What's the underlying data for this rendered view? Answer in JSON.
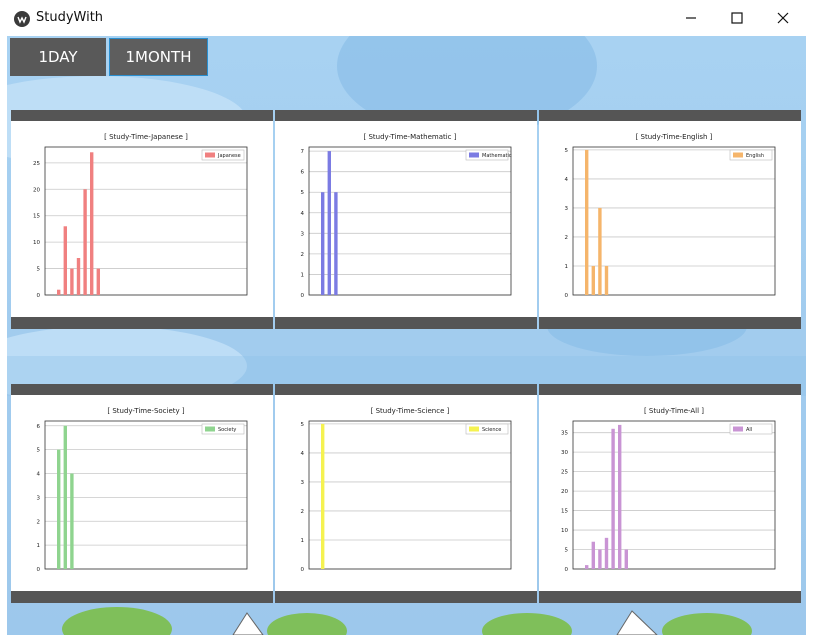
{
  "window": {
    "title": "StudyWith"
  },
  "toolbar": {
    "tab_day": "1DAY",
    "tab_month": "1MONTH",
    "active_tab": "1MONTH"
  },
  "chart_data": [
    {
      "type": "bar",
      "title": "[ Study-Time-Japanese ]",
      "series": [
        {
          "name": "Japanese",
          "values": [
            1,
            13,
            5,
            7,
            20,
            27,
            5
          ]
        }
      ],
      "color": "#f08080",
      "ylim": [
        0,
        28
      ],
      "yticks": [
        "0",
        "5",
        "10",
        "15",
        "20",
        "25"
      ],
      "grid": true,
      "legend": "top-right"
    },
    {
      "type": "bar",
      "title": "[ Study-Time-Mathematic ]",
      "series": [
        {
          "name": "Mathematic",
          "values": [
            5,
            7,
            5
          ]
        }
      ],
      "color": "#7b7be3",
      "ylim": [
        0,
        7.2
      ],
      "yticks": [
        "0",
        "1",
        "2",
        "3",
        "4",
        "5",
        "6",
        "7"
      ],
      "grid": true,
      "legend": "top-right"
    },
    {
      "type": "bar",
      "title": "[ Study-Time-English ]",
      "series": [
        {
          "name": "English",
          "values": [
            5,
            1,
            3,
            1
          ]
        }
      ],
      "color": "#f5b56b",
      "ylim": [
        0,
        5.1
      ],
      "yticks": [
        "0",
        "1",
        "2",
        "3",
        "4",
        "5"
      ],
      "grid": true,
      "legend": "top-right"
    },
    {
      "type": "bar",
      "title": "[ Study-Time-Society ]",
      "series": [
        {
          "name": "Society",
          "values": [
            5,
            6,
            4
          ]
        }
      ],
      "color": "#8fd48f",
      "ylim": [
        0,
        6.2
      ],
      "yticks": [
        "0",
        "1",
        "2",
        "3",
        "4",
        "5",
        "6"
      ],
      "grid": true,
      "legend": "top-right"
    },
    {
      "type": "bar",
      "title": "[ Study-Time-Science ]",
      "series": [
        {
          "name": "Science",
          "values": [
            5
          ]
        }
      ],
      "color": "#f5f250",
      "ylim": [
        0,
        5.1
      ],
      "yticks": [
        "0",
        "1",
        "2",
        "3",
        "4",
        "5"
      ],
      "grid": true,
      "legend": "top-right"
    },
    {
      "type": "bar",
      "title": "[ Study-Time-All ]",
      "series": [
        {
          "name": "All",
          "values": [
            1,
            7,
            5,
            8,
            36,
            37,
            5
          ]
        }
      ],
      "color": "#c994d4",
      "ylim": [
        0,
        38
      ],
      "yticks": [
        "0",
        "5",
        "10",
        "15",
        "20",
        "25",
        "30",
        "35"
      ],
      "grid": true,
      "legend": "top-right"
    }
  ]
}
